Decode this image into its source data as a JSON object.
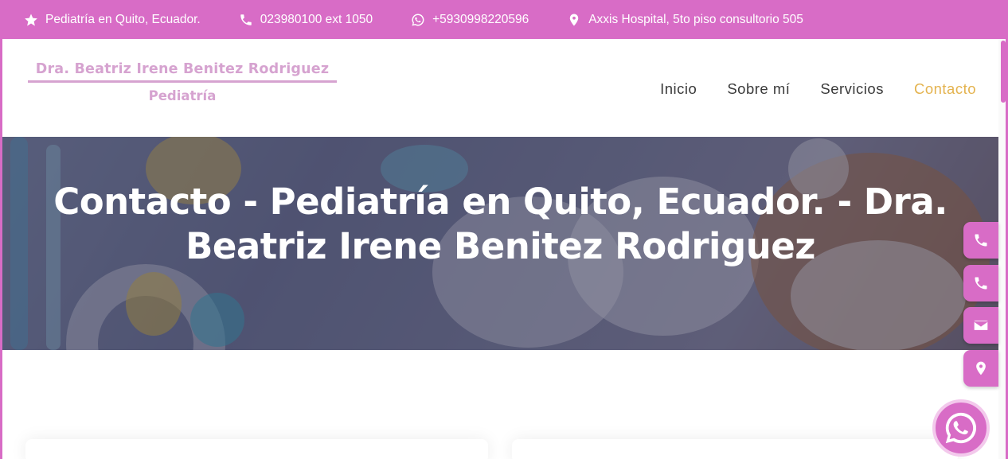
{
  "topbar": {
    "location": "Pediatría en Quito, Ecuador.",
    "phone": "023980100 ext 1050",
    "whatsapp": "+5930998220596",
    "address": "Axxis Hospital, 5to piso consultorio 505"
  },
  "logo": {
    "name": "Dra. Beatriz Irene Benitez Rodriguez",
    "specialty": "Pediatría"
  },
  "nav": {
    "items": [
      "Inicio",
      "Sobre mí",
      "Servicios",
      "Contacto"
    ],
    "active": "Contacto"
  },
  "hero": {
    "title": "Contacto - Pediatría en Quito, Ecuador. - Dra. Beatriz Irene Benitez Rodriguez"
  },
  "floating_buttons": [
    "phone-icon",
    "phone-icon",
    "envelope-icon",
    "map-pin-icon"
  ],
  "whatsapp_button": {
    "icon": "whatsapp-icon"
  },
  "colors": {
    "brand": "#d86cc6",
    "logo": "#d6a3d0",
    "nav_active": "#e4b34f",
    "nav_text": "#3a3a3a"
  }
}
